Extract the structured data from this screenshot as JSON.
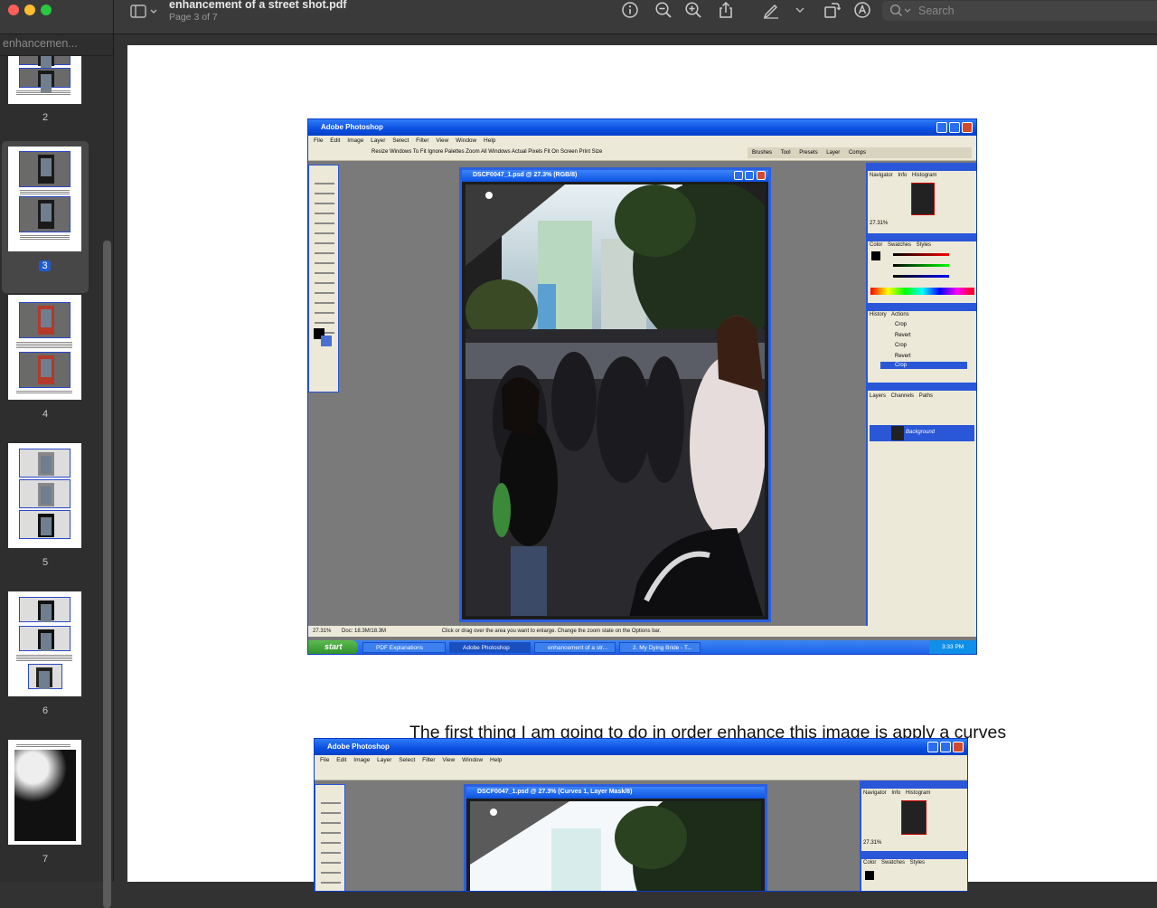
{
  "window": {
    "title": "enhancement of a street shot.pdf",
    "subtitle": "Page 3 of 7",
    "search_placeholder": "Search"
  },
  "toolbar": {
    "icons": [
      "sidebar-icon",
      "chevron-down-icon",
      "info-icon",
      "zoom-out-icon",
      "zoom-in-icon",
      "share-icon",
      "markup-pen-icon",
      "chevron-down-icon",
      "rotate-icon",
      "annotate-icon",
      "search-icon"
    ]
  },
  "sidebar": {
    "title": "enhancemen...",
    "pages": [
      {
        "num": "2"
      },
      {
        "num": "3",
        "selected": true
      },
      {
        "num": "4"
      },
      {
        "num": "5"
      },
      {
        "num": "6"
      },
      {
        "num": "7"
      }
    ]
  },
  "document": {
    "paragraph": "The first thing I am going to do in order enhance this image is apply a curves adjustment layer in order to make colours more natural and stuff.",
    "screenshot1": {
      "app_title": "Adobe Photoshop",
      "menu": "File Edit Image Layer Select Filter View Window Help",
      "options": "Resize Windows To Fit   Ignore Palettes   Zoom All Windows   Actual Pixels   Fit On Screen   Print Size",
      "doc_title": "DSCF0047_1.psd @ 27.3% (RGB/8)",
      "status_zoom": "27.31%",
      "status_doc": "Doc: 18.3M/18.3M",
      "status_hint": "Click or drag over the area you want to enlarge. Change the zoom state on the Options bar.",
      "palette_tabs": [
        "Brushes",
        "Tool Presets",
        "Layer Comps"
      ],
      "navigator_tabs": "Navigator  Info  Histogram",
      "color_tabs": "Color  Swatches  Styles",
      "history_tabs": "History  Actions",
      "history_items": [
        "Crop",
        "Revert",
        "Crop",
        "Revert",
        "Crop"
      ],
      "layers_tabs": "Layers  Channels  Paths",
      "layer_name": "Background",
      "taskbar": {
        "start": "start",
        "tasks": [
          "PDF Explanations",
          "Adobe Photoshop",
          "enhancement of a str...",
          "2. My Dying Bride - T..."
        ],
        "clock": "3:33 PM"
      }
    },
    "screenshot2": {
      "app_title": "Adobe Photoshop",
      "menu": "File Edit Image Layer Select Filter View Window Help",
      "doc_title": "DSCF0047_1.psd @ 27.3% (Curves 1, Layer Mask/8)",
      "navigator_tabs": "Navigator  Info  Histogram",
      "color_tabs": "Color  Swatches  Styles",
      "zoom": "27.31%"
    }
  },
  "colors": {
    "accent": "#1e5bd6",
    "xp_blue": "#0a4fe0",
    "xp_panel": "#ece9d8"
  }
}
